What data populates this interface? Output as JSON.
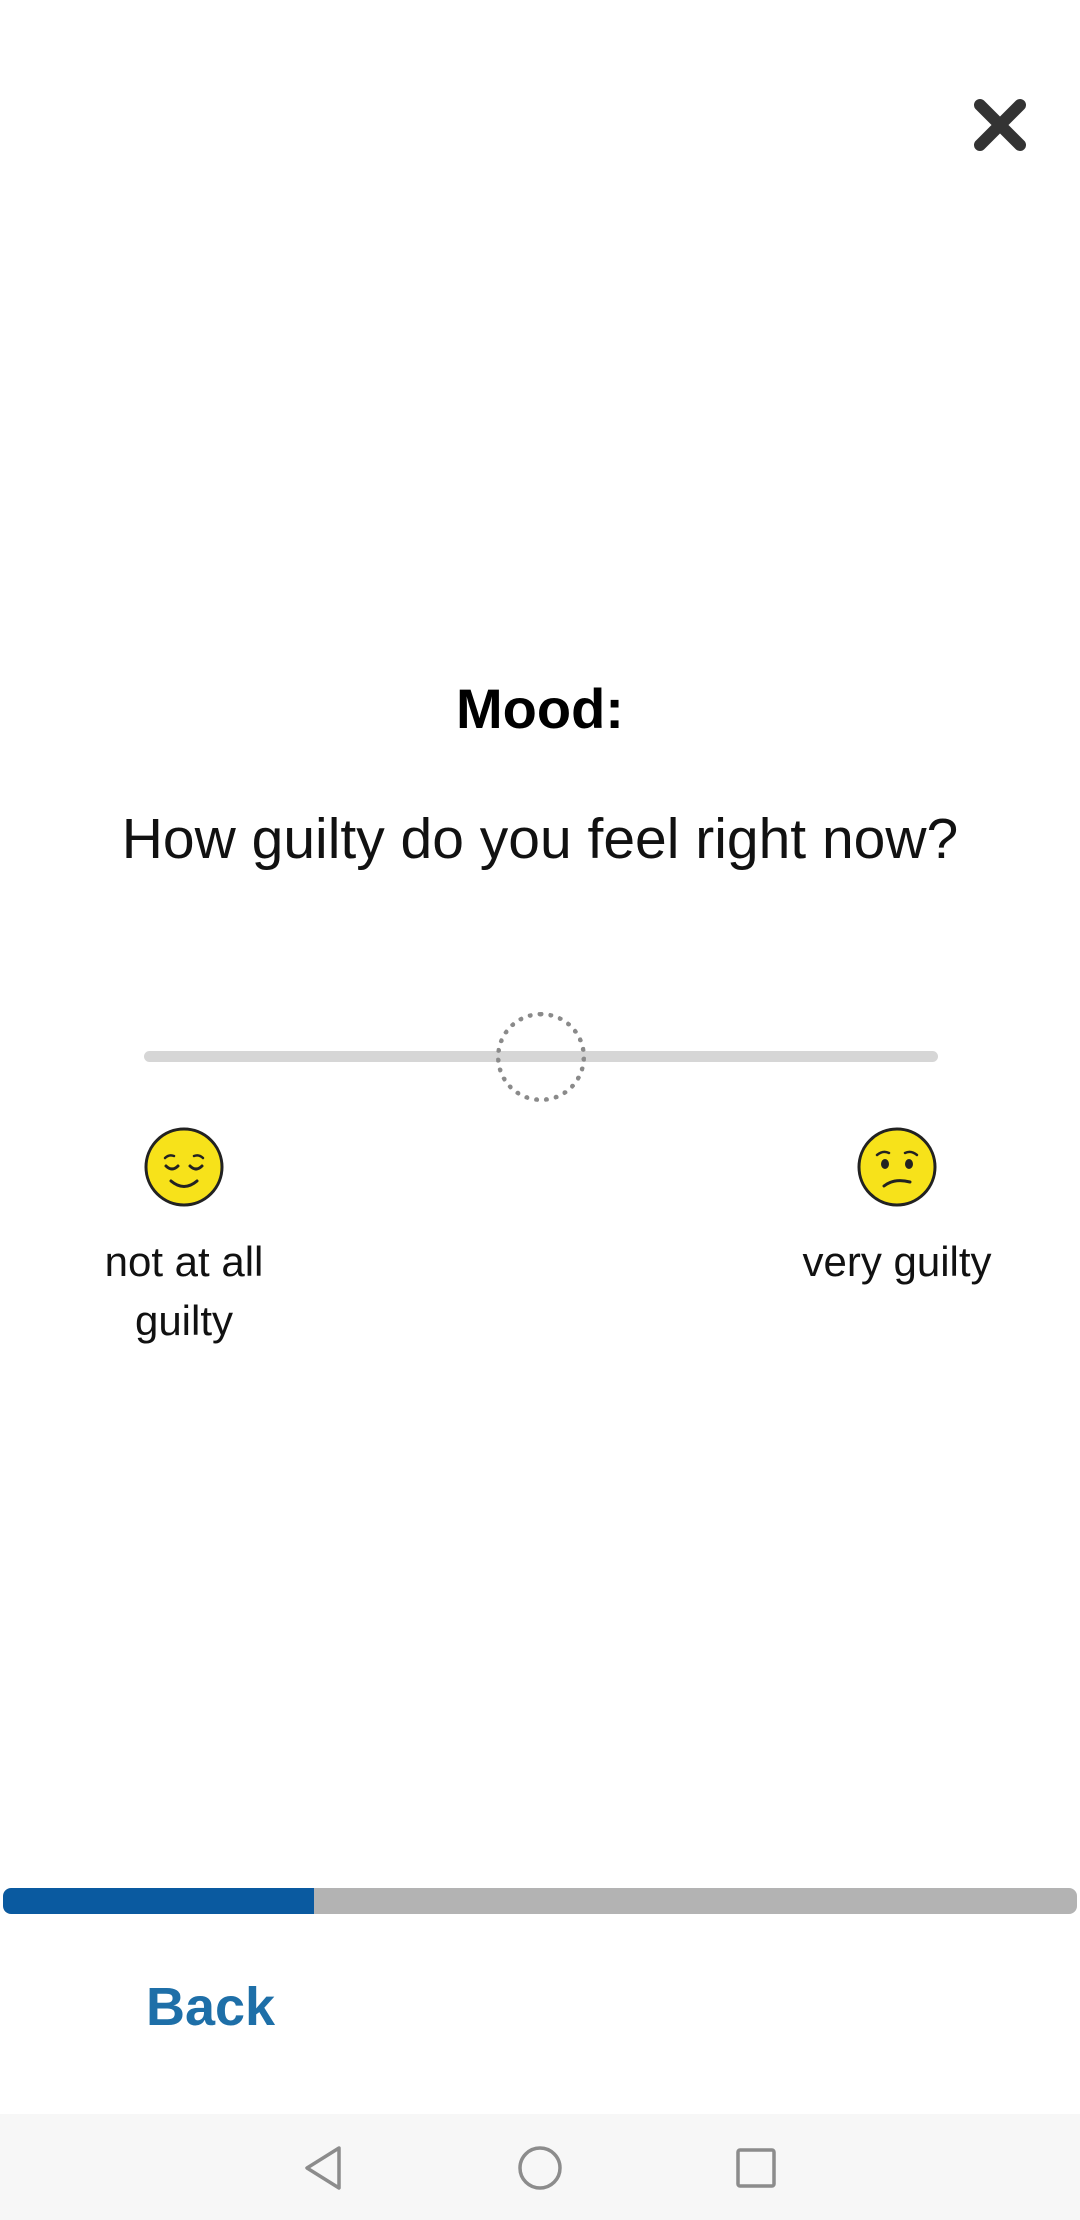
{
  "header": {
    "close_icon": "close-icon"
  },
  "question": {
    "title": "Mood:",
    "text": "How guilty do you feel right now?"
  },
  "slider": {
    "value_fraction": 0.5,
    "min_label": "not at all guilty",
    "max_label": "very guilty",
    "min_icon": "relieved-face-icon",
    "max_icon": "confused-face-icon",
    "track_color": "#d6d6d6",
    "thumb_color": "#8a8a8a"
  },
  "progress": {
    "fraction": 0.29,
    "fill_color": "#0a5aa0",
    "track_color": "#b3b3b3"
  },
  "footer": {
    "back_label": "Back",
    "back_color": "#1e6fa8"
  },
  "system_nav": {
    "back_icon": "triangle-back-icon",
    "home_icon": "circle-home-icon",
    "recents_icon": "square-recents-icon"
  }
}
